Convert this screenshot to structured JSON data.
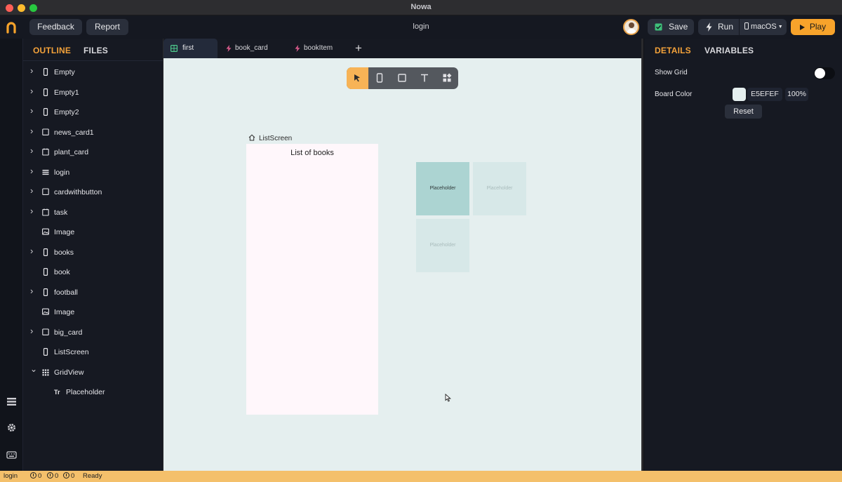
{
  "window": {
    "title": "Nowa"
  },
  "toolbar": {
    "feedback_label": "Feedback",
    "report_label": "Report",
    "screen_name": "login",
    "save_label": "Save",
    "run_label": "Run",
    "platform_label": "macOS",
    "play_label": "Play"
  },
  "left_panel": {
    "tabs": [
      "OUTLINE",
      "FILES"
    ],
    "active_tab": "OUTLINE",
    "items": [
      {
        "label": "Empty",
        "icon": "phone-icon",
        "expandable": true
      },
      {
        "label": "Empty1",
        "icon": "phone-icon",
        "expandable": true
      },
      {
        "label": "Empty2",
        "icon": "phone-icon",
        "expandable": true
      },
      {
        "label": "news_card1",
        "icon": "square-icon",
        "expandable": true
      },
      {
        "label": "plant_card",
        "icon": "card-icon",
        "expandable": true
      },
      {
        "label": "login",
        "icon": "list-icon",
        "expandable": true
      },
      {
        "label": "cardwithbutton",
        "icon": "square-icon",
        "expandable": true
      },
      {
        "label": "task",
        "icon": "card-icon",
        "expandable": true
      },
      {
        "label": "Image",
        "icon": "image-icon",
        "expandable": false
      },
      {
        "label": "books",
        "icon": "phone-icon",
        "expandable": true
      },
      {
        "label": "book",
        "icon": "phone-icon",
        "expandable": false
      },
      {
        "label": "football",
        "icon": "phone-icon",
        "expandable": true
      },
      {
        "label": "Image",
        "icon": "image-icon",
        "expandable": false
      },
      {
        "label": "big_card",
        "icon": "square-icon",
        "expandable": true
      },
      {
        "label": "ListScreen",
        "icon": "phone-icon",
        "expandable": false
      },
      {
        "label": "GridView",
        "icon": "grid-icon",
        "expandable": true,
        "expanded": true
      },
      {
        "label": "Placeholder",
        "icon": "text-icon",
        "expandable": false,
        "child": true
      }
    ]
  },
  "file_tabs": [
    {
      "label": "first",
      "icon": "grid-icon",
      "active": true
    },
    {
      "label": "book_card",
      "icon": "bolt-icon",
      "active": false
    },
    {
      "label": "bookItem",
      "icon": "bolt-icon",
      "active": false
    }
  ],
  "add_tab_label": "+",
  "canvas": {
    "background_color": "#e5efef",
    "tools": [
      "pointer-icon",
      "phone-icon",
      "square-icon",
      "text-icon",
      "widgets-icon"
    ],
    "active_tool": "pointer-icon",
    "screen_label": "ListScreen",
    "phone_title": "List of books",
    "grid_items": [
      "Placeholder",
      "Placeholder",
      "Placeholder"
    ]
  },
  "right_panel": {
    "tabs": [
      "DETAILS",
      "VARIABLES"
    ],
    "active_tab": "DETAILS",
    "show_grid_label": "Show Grid",
    "show_grid_on": false,
    "board_color_label": "Board Color",
    "board_color_hex": "E5EFEF",
    "board_color_opacity": "100%",
    "reset_label": "Reset"
  },
  "status_bar": {
    "screen": "login",
    "errors": "0",
    "warnings": "0",
    "infos": "0",
    "status": "Ready"
  },
  "colors": {
    "accent": "#f7a32b",
    "status_bar": "#f4c06b",
    "panel_bg": "#161922"
  }
}
